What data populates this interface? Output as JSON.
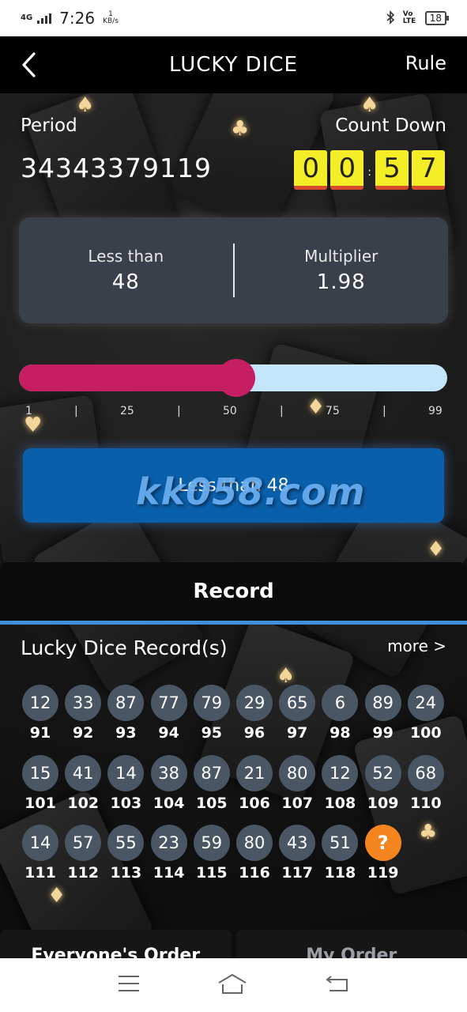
{
  "status_bar": {
    "network": "4G",
    "time": "7:26",
    "speed_value": "1",
    "speed_unit": "KB/s",
    "volte_label": "Vo LTE",
    "battery": "18"
  },
  "header": {
    "title": "LUCKY DICE",
    "rule_label": "Rule"
  },
  "period": {
    "label": "Period",
    "number": "34343379119"
  },
  "countdown": {
    "label": "Count Down",
    "digits": [
      "0",
      "0",
      "5",
      "7"
    ]
  },
  "bet_info": {
    "condition_label": "Less than",
    "condition_value": "48",
    "multiplier_label": "Multiplier",
    "multiplier_value": "1.98"
  },
  "slider": {
    "value": 48,
    "min": 1,
    "max": 99,
    "tick_labels": [
      "1",
      "|",
      "25",
      "|",
      "50",
      "|",
      "75",
      "|",
      "99"
    ]
  },
  "action_button_label": "Less than 48",
  "watermark_text": "kk058.com",
  "record": {
    "tab_label": "Record",
    "title": "Lucky Dice Record(s)",
    "more_label": "more >",
    "items": [
      {
        "result": "12",
        "issue": "91"
      },
      {
        "result": "33",
        "issue": "92"
      },
      {
        "result": "87",
        "issue": "93"
      },
      {
        "result": "77",
        "issue": "94"
      },
      {
        "result": "79",
        "issue": "95"
      },
      {
        "result": "29",
        "issue": "96"
      },
      {
        "result": "65",
        "issue": "97"
      },
      {
        "result": "6",
        "issue": "98"
      },
      {
        "result": "89",
        "issue": "99"
      },
      {
        "result": "24",
        "issue": "100"
      },
      {
        "result": "15",
        "issue": "101"
      },
      {
        "result": "41",
        "issue": "102"
      },
      {
        "result": "14",
        "issue": "103"
      },
      {
        "result": "38",
        "issue": "104"
      },
      {
        "result": "87",
        "issue": "105"
      },
      {
        "result": "21",
        "issue": "106"
      },
      {
        "result": "80",
        "issue": "107"
      },
      {
        "result": "12",
        "issue": "108"
      },
      {
        "result": "52",
        "issue": "109"
      },
      {
        "result": "68",
        "issue": "110"
      },
      {
        "result": "14",
        "issue": "111"
      },
      {
        "result": "57",
        "issue": "112"
      },
      {
        "result": "55",
        "issue": "113"
      },
      {
        "result": "23",
        "issue": "114"
      },
      {
        "result": "59",
        "issue": "115"
      },
      {
        "result": "80",
        "issue": "116"
      },
      {
        "result": "43",
        "issue": "117"
      },
      {
        "result": "51",
        "issue": "118"
      },
      {
        "result": "?",
        "issue": "119",
        "pending": true
      }
    ]
  },
  "bottom_tabs": [
    "Everyone's Order",
    "My Order"
  ],
  "colors": {
    "accent_blue": "#0a5fab",
    "slider_fill": "#c51f62",
    "slider_track": "#c4e6fa",
    "digit_bg": "#f4ee27",
    "pending_ball": "#f5861f",
    "ball": "#4a5663"
  }
}
